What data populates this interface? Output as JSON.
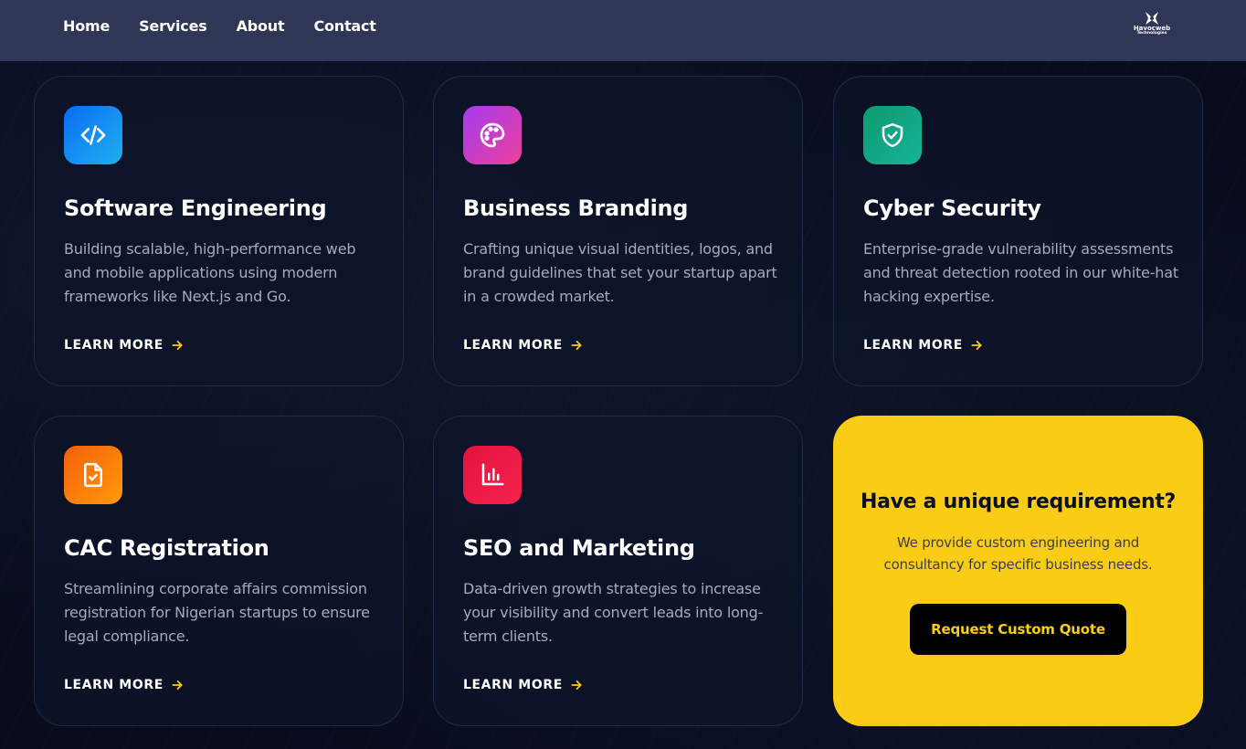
{
  "nav": {
    "links": [
      {
        "label": "Home"
      },
      {
        "label": "Services"
      },
      {
        "label": "About"
      },
      {
        "label": "Contact"
      }
    ],
    "logo": {
      "name": "Havocweb",
      "sub": "Technologies"
    }
  },
  "services": [
    {
      "title": "Software Engineering",
      "description": "Building scalable, high-performance web and mobile applications using modern frameworks like Next.js and Go.",
      "link": "LEARN MORE",
      "icon": "code-icon",
      "color_from": "#0a6cf2",
      "color_to": "#1fb0f0"
    },
    {
      "title": "Business Branding",
      "description": "Crafting unique visual identities, logos, and brand guidelines that set your startup apart in a crowded market.",
      "link": "LEARN MORE",
      "icon": "palette-icon",
      "color_from": "#a43cf0",
      "color_to": "#ec3f9a"
    },
    {
      "title": "Cyber Security",
      "description": "Enterprise-grade vulnerability assessments and threat detection rooted in our white-hat hacking expertise.",
      "link": "LEARN MORE",
      "icon": "shield-check-icon",
      "color_from": "#0f9a6e",
      "color_to": "#14b39a"
    },
    {
      "title": "CAC Registration",
      "description": "Streamlining corporate affairs commission registration for Nigerian startups to ensure legal compliance.",
      "link": "LEARN MORE",
      "icon": "file-check-icon",
      "color_from": "#f5600d",
      "color_to": "#ff9a0a"
    },
    {
      "title": "SEO and Marketing",
      "description": "Data-driven growth strategies to increase your visibility and convert leads into long-term clients.",
      "link": "LEARN MORE",
      "icon": "bar-chart-icon",
      "color_from": "#e5123d",
      "color_to": "#f5234f"
    }
  ],
  "cta": {
    "title": "Have a unique requirement?",
    "description": "We provide custom engineering and consultancy for specific business needs.",
    "button": "Request Custom Quote"
  },
  "colors": {
    "accent": "#facc15",
    "nav_bg": "#2f3656",
    "page_bg": "#080c1d"
  }
}
